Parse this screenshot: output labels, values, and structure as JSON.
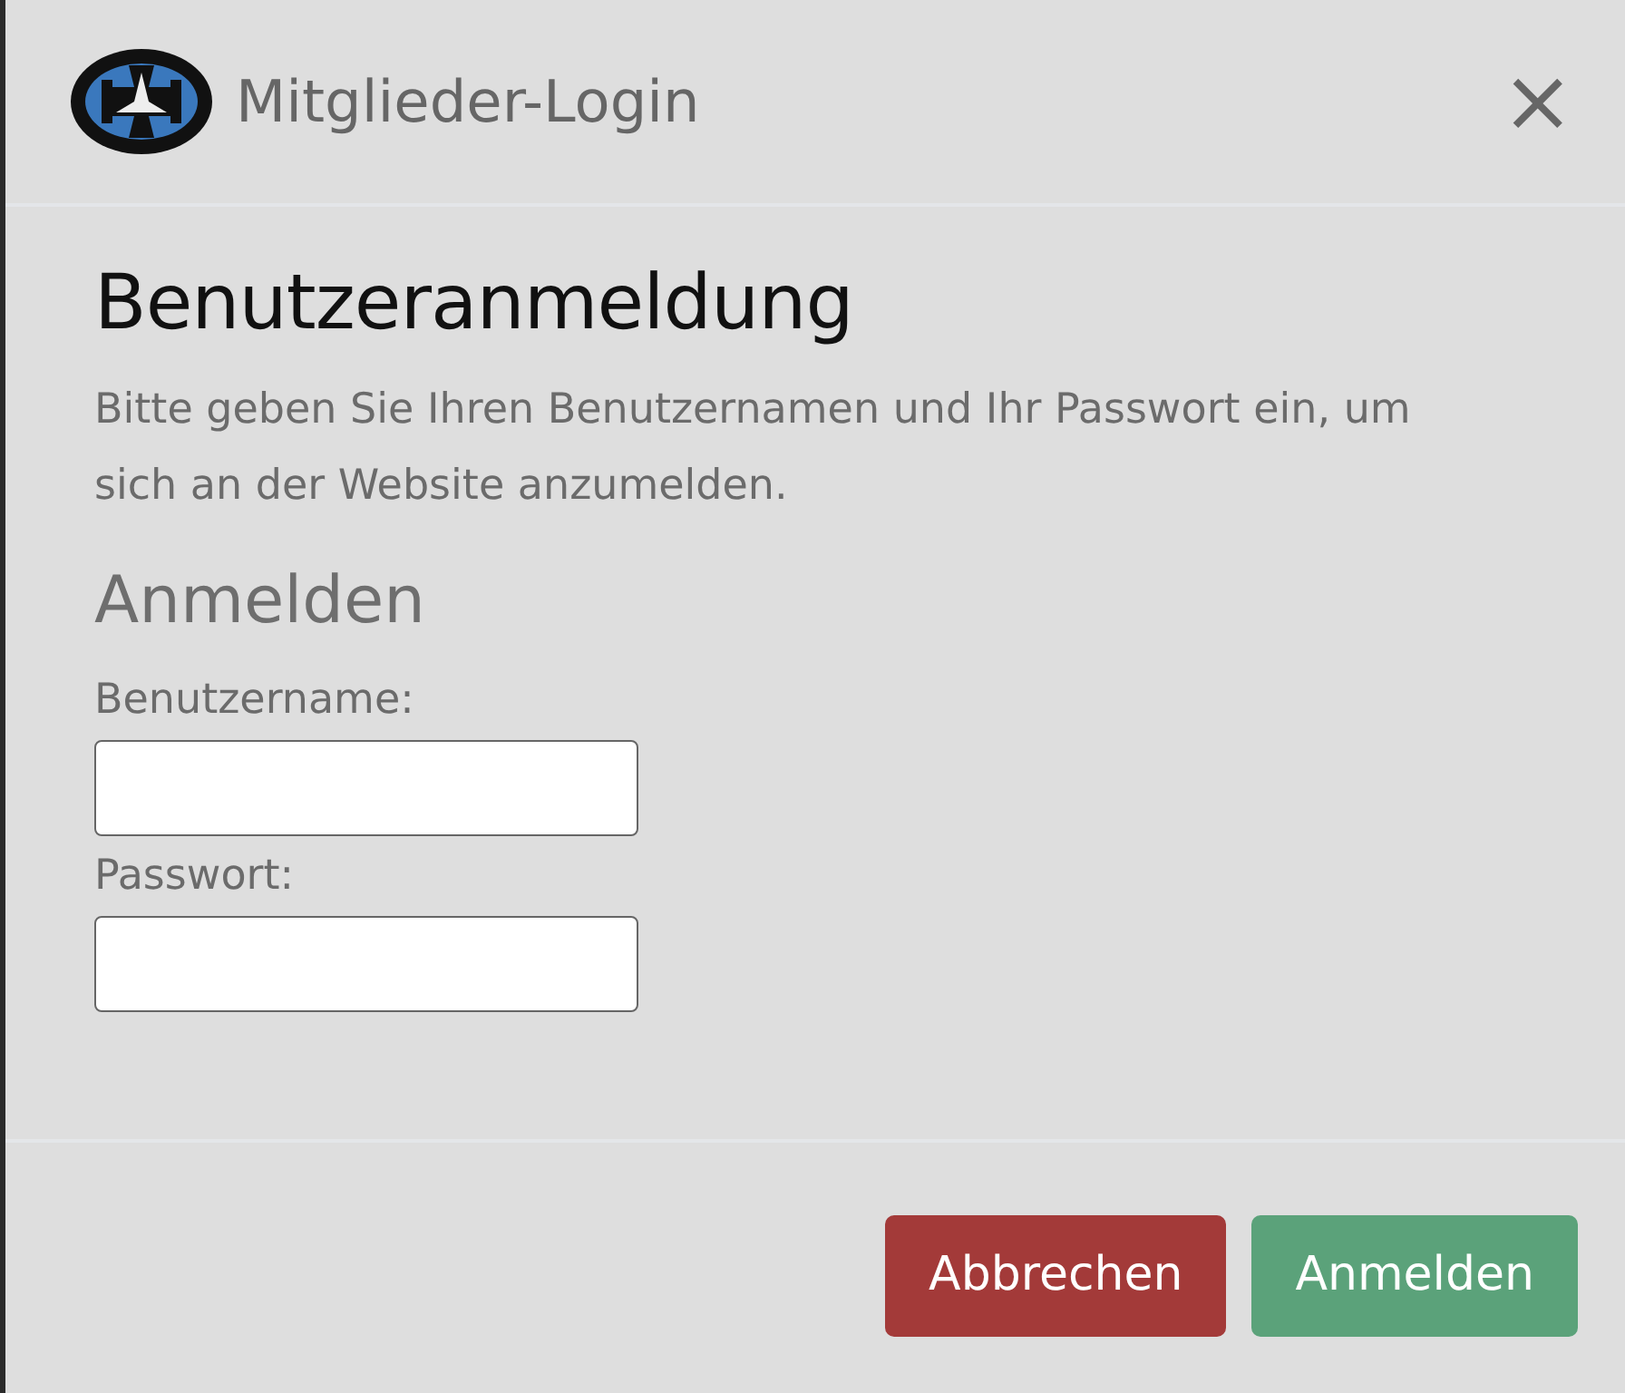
{
  "header": {
    "title": "Mitglieder-Login",
    "close": "×"
  },
  "body": {
    "heading": "Benutzeranmeldung",
    "intro": "Bitte geben Sie Ihren Benutzernamen und Ihr Passwort ein, um sich an der Website anzumelden.",
    "form_title": "Anmelden",
    "fields": [
      {
        "label": "Benutzername:"
      },
      {
        "label": "Passwort:"
      }
    ]
  },
  "buttons": [
    {
      "label": "Abbrechen",
      "kind": "cancel"
    },
    {
      "label": "Anmelden",
      "kind": "submit"
    }
  ]
}
